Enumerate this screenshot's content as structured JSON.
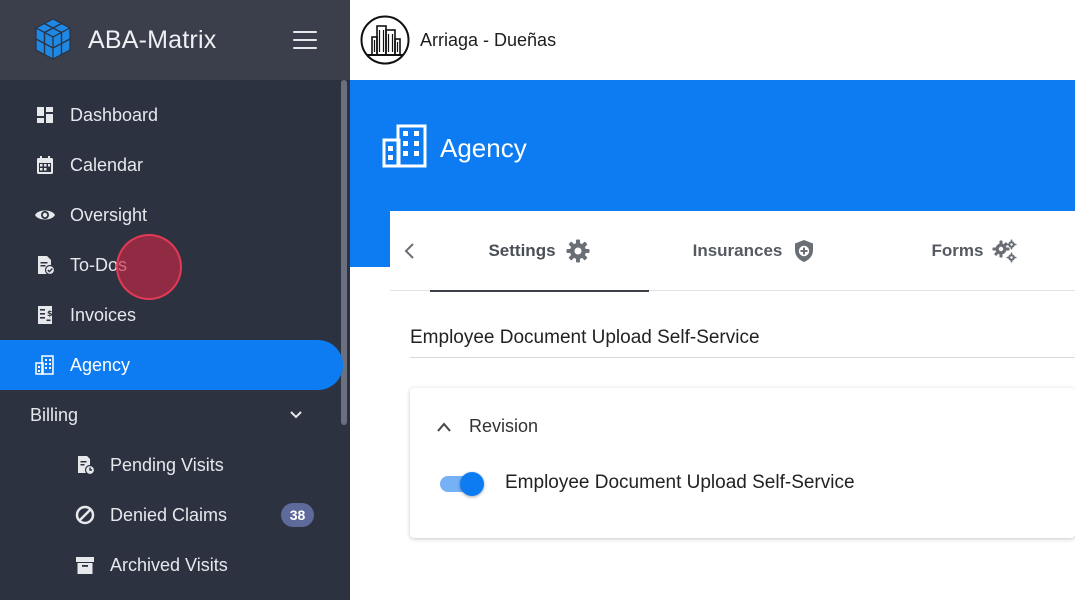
{
  "app": {
    "title": "ABA-Matrix",
    "accent_color": "#0d7cf2",
    "sidebar_color": "#2c3240"
  },
  "organization": {
    "name": "Arriaga - Dueñas"
  },
  "sidebar": {
    "items": [
      {
        "label": "Dashboard",
        "icon": "dashboard-icon"
      },
      {
        "label": "Calendar",
        "icon": "calendar-icon"
      },
      {
        "label": "Oversight",
        "icon": "eye-icon"
      },
      {
        "label": "To-Dos",
        "icon": "todo-document-icon"
      },
      {
        "label": "Invoices",
        "icon": "invoice-icon"
      },
      {
        "label": "Agency",
        "icon": "building-icon",
        "active": true
      }
    ],
    "groups": [
      {
        "label": "Billing",
        "expanded": true,
        "items": [
          {
            "label": "Pending Visits",
            "icon": "pending-visits-icon"
          },
          {
            "label": "Denied Claims",
            "icon": "ban-icon",
            "badge": "38"
          },
          {
            "label": "Archived Visits",
            "icon": "archive-icon"
          }
        ]
      }
    ]
  },
  "page": {
    "title": "Agency"
  },
  "tabs": [
    {
      "label": "Settings",
      "icon": "gear-icon",
      "active": true
    },
    {
      "label": "Insurances",
      "icon": "shield-plus-icon",
      "active": false
    },
    {
      "label": "Forms",
      "icon": "gears-icon",
      "active": false
    }
  ],
  "content": {
    "section_title": "Employee Document Upload Self-Service",
    "panel": {
      "title": "Revision",
      "expanded": true,
      "toggle_label": "Employee Document Upload Self-Service",
      "toggle_on": true
    }
  }
}
